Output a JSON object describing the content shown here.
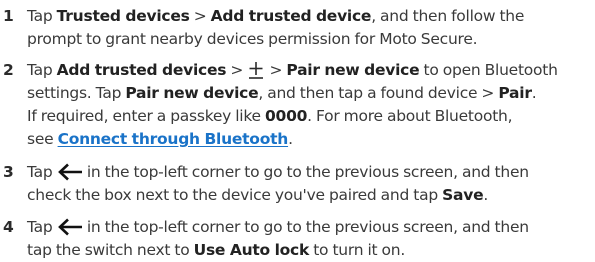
{
  "steps": [
    {
      "number": "1",
      "lines": [
        {
          "t1": "Tap ",
          "b1": "Trusted devices",
          "t2": " > ",
          "b2": "Add trusted device",
          "t3": ", and then follow the"
        },
        {
          "t1": "prompt to grant nearby devices permission for Moto Secure."
        }
      ]
    },
    {
      "number": "2",
      "lines": [
        {
          "t1": "Tap ",
          "b1": "Add trusted devices",
          "t2": " > ",
          "icon": "plus-icon",
          "t3": " > ",
          "b2": "Pair new device",
          "t4": " to open Bluetooth"
        },
        {
          "t1": "settings. Tap ",
          "b1": "Pair new device",
          "t2": ", and then tap a found device > ",
          "b2": "Pair",
          "t3": "."
        },
        {
          "t1": "If required, enter a passkey like ",
          "b1": "0000",
          "t2": ". For more about Bluetooth,"
        },
        {
          "t1": "see ",
          "link": "Connect through Bluetooth",
          "t2": "."
        }
      ]
    },
    {
      "number": "3",
      "lines": [
        {
          "t1": "Tap ",
          "icon": "back-arrow-icon",
          "t2": " in the top-left corner to go to the previous screen, and then"
        },
        {
          "t1": "check the box next to the device you've paired and tap ",
          "b1": "Save",
          "t2": "."
        }
      ]
    },
    {
      "number": "4",
      "lines": [
        {
          "t1": "Tap ",
          "icon": "back-arrow-icon",
          "t2": " in the top-left corner to go to the previous screen, and then"
        },
        {
          "t1": "tap the switch next to ",
          "b1": "Use Auto lock",
          "t2": " to turn it on."
        }
      ]
    }
  ]
}
